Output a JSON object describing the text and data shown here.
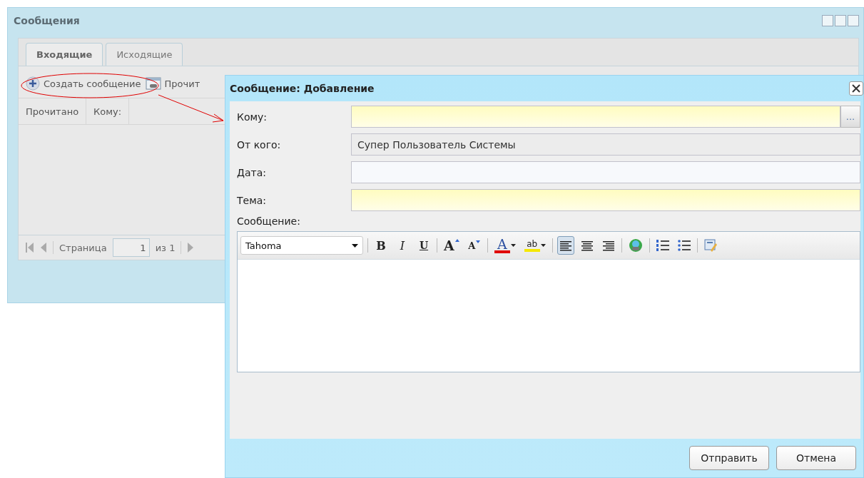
{
  "window": {
    "title": "Сообщения",
    "tabs": [
      {
        "label": "Входящие",
        "selected": true
      },
      {
        "label": "Исходящие",
        "selected": false
      }
    ],
    "toolbar": {
      "create_button": "Создать сообщение",
      "read_button": "Прочит"
    },
    "columns": [
      "Прочитано",
      "Кому:"
    ],
    "pager": {
      "page_label": "Страница",
      "page_value": "1",
      "of_label": "из 1"
    }
  },
  "dialog": {
    "title": "Сообщение: Добавление",
    "fields": [
      {
        "label": "Кому:",
        "kind": "picker",
        "required": true,
        "readonly": false,
        "picker_glyph": "..."
      },
      {
        "label": "От кого:",
        "kind": "text",
        "required": false,
        "readonly": true,
        "value": "Супер Пользователь Системы"
      },
      {
        "label": "Дата:",
        "kind": "text",
        "required": false,
        "readonly": false
      },
      {
        "label": "Тема:",
        "kind": "text",
        "required": true,
        "readonly": false
      }
    ],
    "message_label": "Сообщение:",
    "editor": {
      "font": "Tahoma",
      "tools": [
        {
          "kind": "bold",
          "glyph": "B"
        },
        {
          "kind": "italic",
          "glyph": "I"
        },
        {
          "kind": "underline",
          "glyph": "U"
        },
        {
          "kind": "separator"
        },
        {
          "kind": "grow",
          "glyph": "A"
        },
        {
          "kind": "shrink",
          "glyph": "A"
        },
        {
          "kind": "separator"
        },
        {
          "kind": "font-color",
          "glyph": "A"
        },
        {
          "kind": "highlight",
          "glyph": "ab"
        },
        {
          "kind": "separator"
        },
        {
          "kind": "align-left",
          "selected": true
        },
        {
          "kind": "align-center",
          "selected": false
        },
        {
          "kind": "align-right",
          "selected": false
        },
        {
          "kind": "separator"
        },
        {
          "kind": "link"
        },
        {
          "kind": "separator"
        },
        {
          "kind": "ordered-list"
        },
        {
          "kind": "bullet-list"
        },
        {
          "kind": "separator"
        },
        {
          "kind": "source"
        }
      ]
    },
    "buttons": [
      "Отправить",
      "Отмена"
    ]
  }
}
